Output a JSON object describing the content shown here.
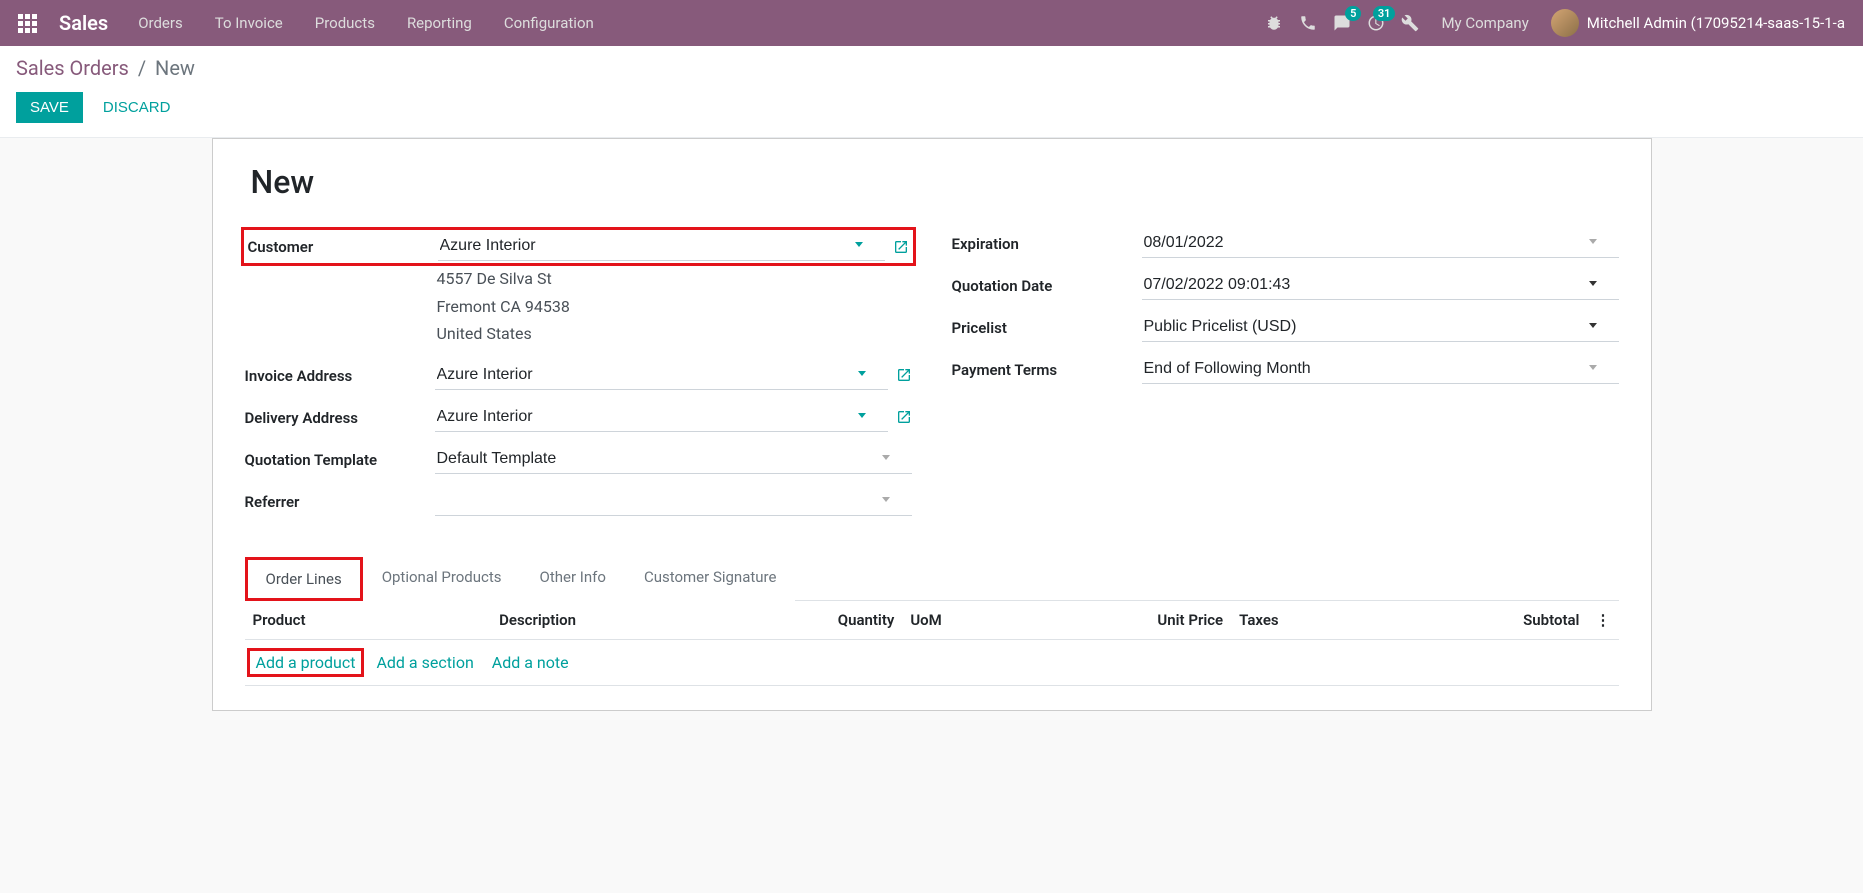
{
  "navbar": {
    "brand": "Sales",
    "menu": [
      "Orders",
      "To Invoice",
      "Products",
      "Reporting",
      "Configuration"
    ],
    "messages_badge": "5",
    "activities_badge": "31",
    "company": "My Company",
    "user": "Mitchell Admin (17095214-saas-15-1-a"
  },
  "breadcrumb": {
    "parent": "Sales Orders",
    "current": "New"
  },
  "actions": {
    "save": "SAVE",
    "discard": "DISCARD"
  },
  "form": {
    "title": "New",
    "left": {
      "customer_label": "Customer",
      "customer_value": "Azure Interior",
      "address_line1": "4557 De Silva St",
      "address_line2": "Fremont CA 94538",
      "address_line3": "United States",
      "invoice_addr_label": "Invoice Address",
      "invoice_addr_value": "Azure Interior",
      "delivery_addr_label": "Delivery Address",
      "delivery_addr_value": "Azure Interior",
      "quot_tmpl_label": "Quotation Template",
      "quot_tmpl_value": "Default Template",
      "referrer_label": "Referrer",
      "referrer_value": ""
    },
    "right": {
      "expiration_label": "Expiration",
      "expiration_value": "08/01/2022",
      "quot_date_label": "Quotation Date",
      "quot_date_value": "07/02/2022 09:01:43",
      "pricelist_label": "Pricelist",
      "pricelist_value": "Public Pricelist (USD)",
      "payment_terms_label": "Payment Terms",
      "payment_terms_value": "End of Following Month"
    }
  },
  "tabs": [
    "Order Lines",
    "Optional Products",
    "Other Info",
    "Customer Signature"
  ],
  "table": {
    "headers": {
      "product": "Product",
      "description": "Description",
      "quantity": "Quantity",
      "uom": "UoM",
      "unit_price": "Unit Price",
      "taxes": "Taxes",
      "subtotal": "Subtotal"
    },
    "add_product": "Add a product",
    "add_section": "Add a section",
    "add_note": "Add a note"
  }
}
